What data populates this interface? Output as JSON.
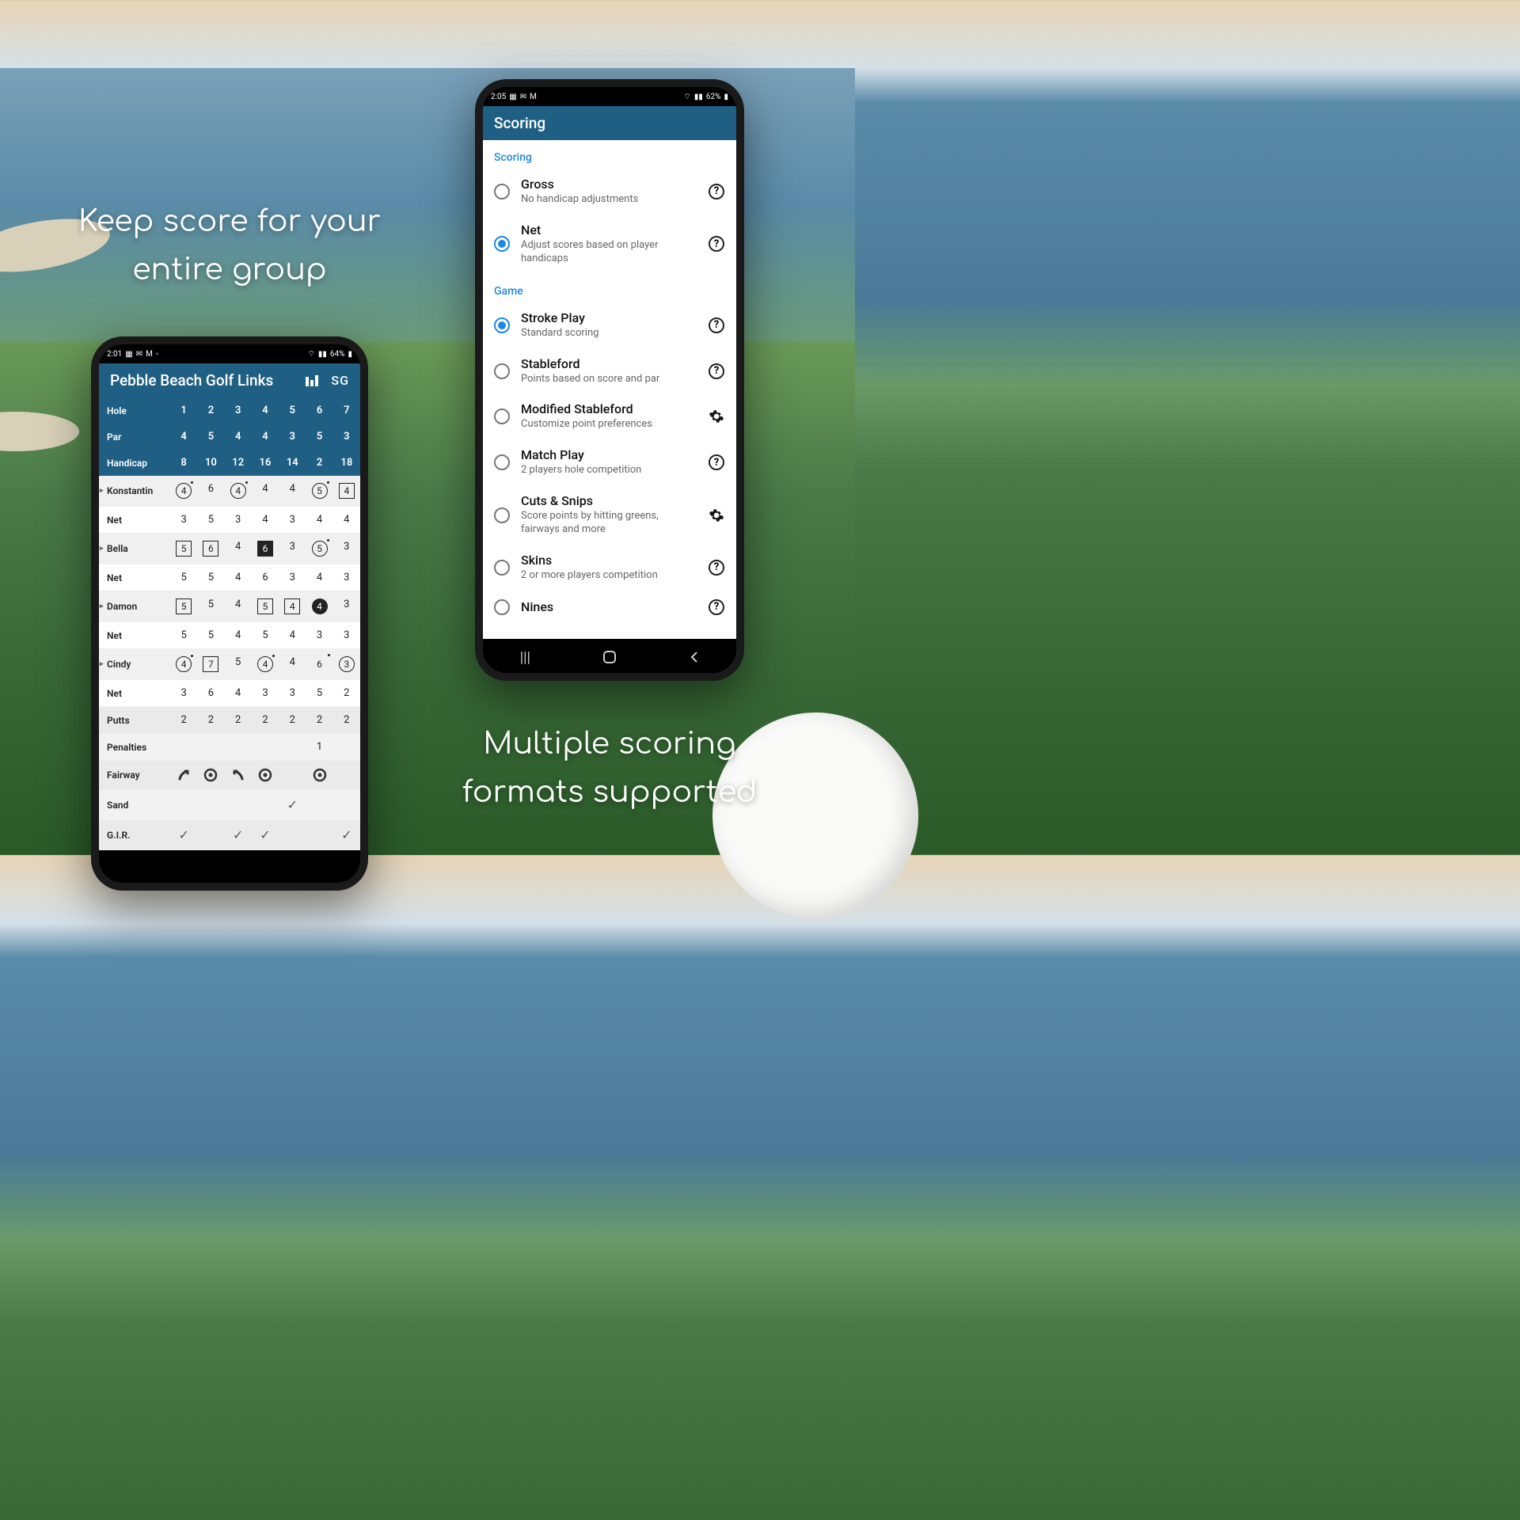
{
  "captions": {
    "c1_line1": "Keep score for your",
    "c1_line2": "entire group",
    "c2_line1": "Multiple scoring",
    "c2_line2": "formats supported"
  },
  "phone_left": {
    "status_time": "2:01",
    "status_battery": "64%",
    "app_title": "Pebble Beach Golf Links",
    "sg_label": "SG",
    "header": {
      "hole_label": "Hole",
      "par_label": "Par",
      "hdcp_label": "Handicap",
      "holes": [
        "1",
        "2",
        "3",
        "4",
        "5",
        "6",
        "7"
      ],
      "pars": [
        "4",
        "5",
        "4",
        "4",
        "3",
        "5",
        "3"
      ],
      "hdcps": [
        "8",
        "10",
        "12",
        "16",
        "14",
        "2",
        "18"
      ]
    },
    "players": [
      {
        "name": "Konstantin",
        "scores": [
          "4",
          "6",
          "4",
          "4",
          "4",
          "5",
          "4"
        ],
        "styles": [
          "circle dot",
          "",
          "circle dot",
          "",
          "",
          "circle dot",
          "square"
        ],
        "net": [
          "3",
          "5",
          "3",
          "4",
          "3",
          "4",
          "4"
        ]
      },
      {
        "name": "Bella",
        "scores": [
          "5",
          "6",
          "4",
          "6",
          "3",
          "5",
          "3"
        ],
        "styles": [
          "square",
          "square",
          "",
          "filled",
          "",
          "circle dot",
          ""
        ],
        "net": [
          "5",
          "5",
          "4",
          "6",
          "3",
          "4",
          "3"
        ]
      },
      {
        "name": "Damon",
        "scores": [
          "5",
          "5",
          "4",
          "5",
          "4",
          "4",
          "3"
        ],
        "styles": [
          "square",
          "",
          "",
          "square",
          "square",
          "filledcircle",
          ""
        ],
        "net": [
          "5",
          "5",
          "4",
          "5",
          "4",
          "3",
          "3"
        ]
      },
      {
        "name": "Cindy",
        "scores": [
          "4",
          "7",
          "5",
          "4",
          "4",
          "6",
          "3"
        ],
        "styles": [
          "circle dot",
          "square",
          "",
          "circle dot",
          "",
          "dot",
          "circle"
        ],
        "net": [
          "3",
          "6",
          "4",
          "3",
          "3",
          "5",
          "2"
        ]
      }
    ],
    "stats": {
      "putts_label": "Putts",
      "putts": [
        "2",
        "2",
        "2",
        "2",
        "2",
        "2",
        "2"
      ],
      "penalties_label": "Penalties",
      "penalties": [
        "",
        "",
        "",
        "",
        "",
        "1",
        ""
      ],
      "fairway_label": "Fairway",
      "fairway": [
        "arrow",
        "target",
        "arrowL",
        "target",
        "",
        "target",
        ""
      ],
      "sand_label": "Sand",
      "sand": [
        "",
        "",
        "",
        "",
        "check",
        "",
        ""
      ],
      "gir_label": "G.I.R.",
      "gir": [
        "check",
        "",
        "check",
        "check",
        "",
        "",
        "check"
      ]
    },
    "net_label": "Net"
  },
  "phone_right": {
    "status_time": "2:05",
    "status_battery": "62%",
    "appbar_title": "Scoring",
    "section_scoring": "Scoring",
    "section_game": "Game",
    "scoring_options": [
      {
        "title": "Gross",
        "sub": "No handicap adjustments",
        "selected": false,
        "trail": "help"
      },
      {
        "title": "Net",
        "sub": "Adjust scores based on player handicaps",
        "selected": true,
        "trail": "help"
      }
    ],
    "game_options": [
      {
        "title": "Stroke Play",
        "sub": "Standard scoring",
        "selected": true,
        "trail": "help"
      },
      {
        "title": "Stableford",
        "sub": "Points based on score and par",
        "selected": false,
        "trail": "help"
      },
      {
        "title": "Modified Stableford",
        "sub": "Customize point preferences",
        "selected": false,
        "trail": "gear"
      },
      {
        "title": "Match Play",
        "sub": "2 players hole competition",
        "selected": false,
        "trail": "help"
      },
      {
        "title": "Cuts & Snips",
        "sub": "Score points by hitting greens, fairways and more",
        "selected": false,
        "trail": "gear"
      },
      {
        "title": "Skins",
        "sub": "2 or more players competition",
        "selected": false,
        "trail": "help"
      },
      {
        "title": "Nines",
        "sub": "",
        "selected": false,
        "trail": "help"
      }
    ]
  }
}
